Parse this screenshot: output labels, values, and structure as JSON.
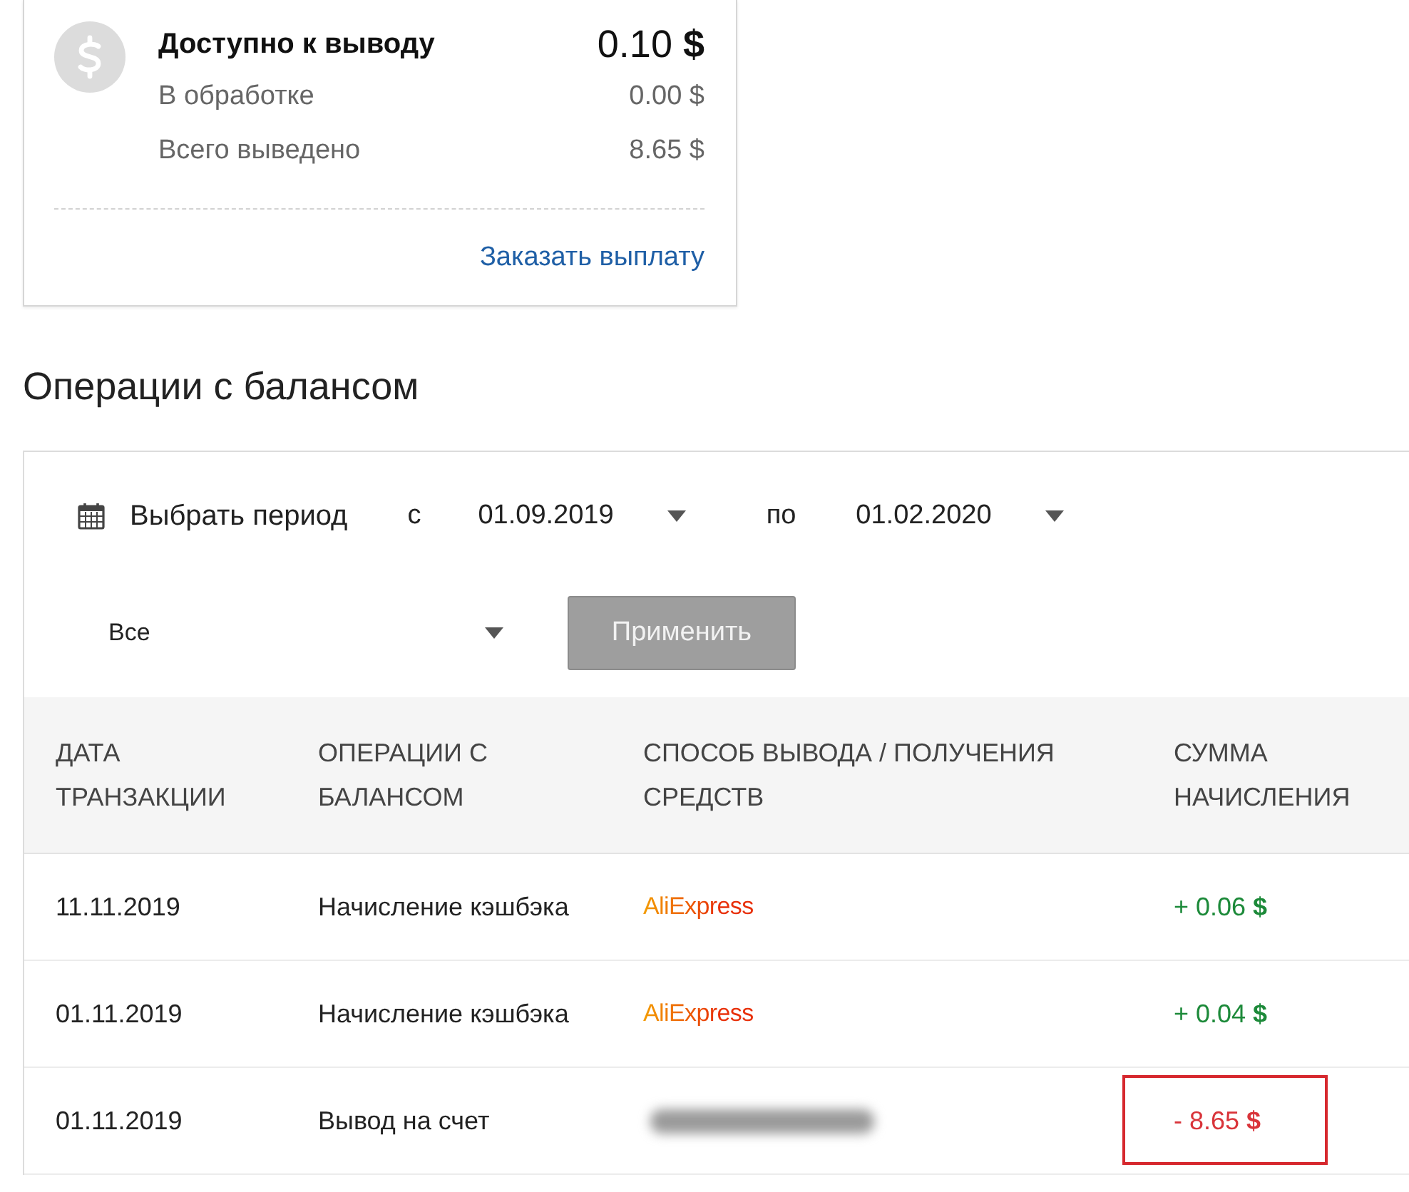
{
  "balance_card": {
    "rows": [
      {
        "kind": "main",
        "label": "Доступно к выводу",
        "value": "0.10 **$**"
      },
      {
        "kind": "sub",
        "label": "В обработке",
        "value": "0.00 $"
      },
      {
        "kind": "sub",
        "label": "Всего выведено",
        "value": "8.65 $"
      }
    ],
    "link": "Заказать выплату"
  },
  "section_title": "Операции с балансом",
  "filter": {
    "period_label": "Выбрать период",
    "from_label": "с",
    "from_value": "01.09.2019",
    "to_label": "по",
    "to_value": "01.02.2020",
    "type_value": "Все",
    "apply_button": "Применить"
  },
  "table": {
    "columns": [
      "ДАТА ТРАНЗАКЦИИ",
      "ОПЕРАЦИИ С БАЛАНСОМ",
      "СПОСОБ ВЫВОДА / ПОЛУЧЕНИЯ СРЕДСТВ",
      "СУММА НАЧИСЛЕНИЯ"
    ],
    "rows": [
      {
        "date": "11.11.2019",
        "operation": "Начисление кэшбэка",
        "method": {
          "kind": "logo",
          "text": "AliExpress"
        },
        "amount": "+ 0.06 **$**",
        "kind": "credit",
        "highlighted": false
      },
      {
        "date": "01.11.2019",
        "operation": "Начисление кэшбэка",
        "method": {
          "kind": "logo",
          "text": "AliExpress"
        },
        "amount": "+ 0.04 **$**",
        "kind": "credit",
        "highlighted": false
      },
      {
        "date": "01.11.2019",
        "operation": "Вывод на счет",
        "method": {
          "kind": "blurred"
        },
        "amount": "- 8.65 **$**",
        "kind": "debit",
        "highlighted": true
      }
    ]
  }
}
